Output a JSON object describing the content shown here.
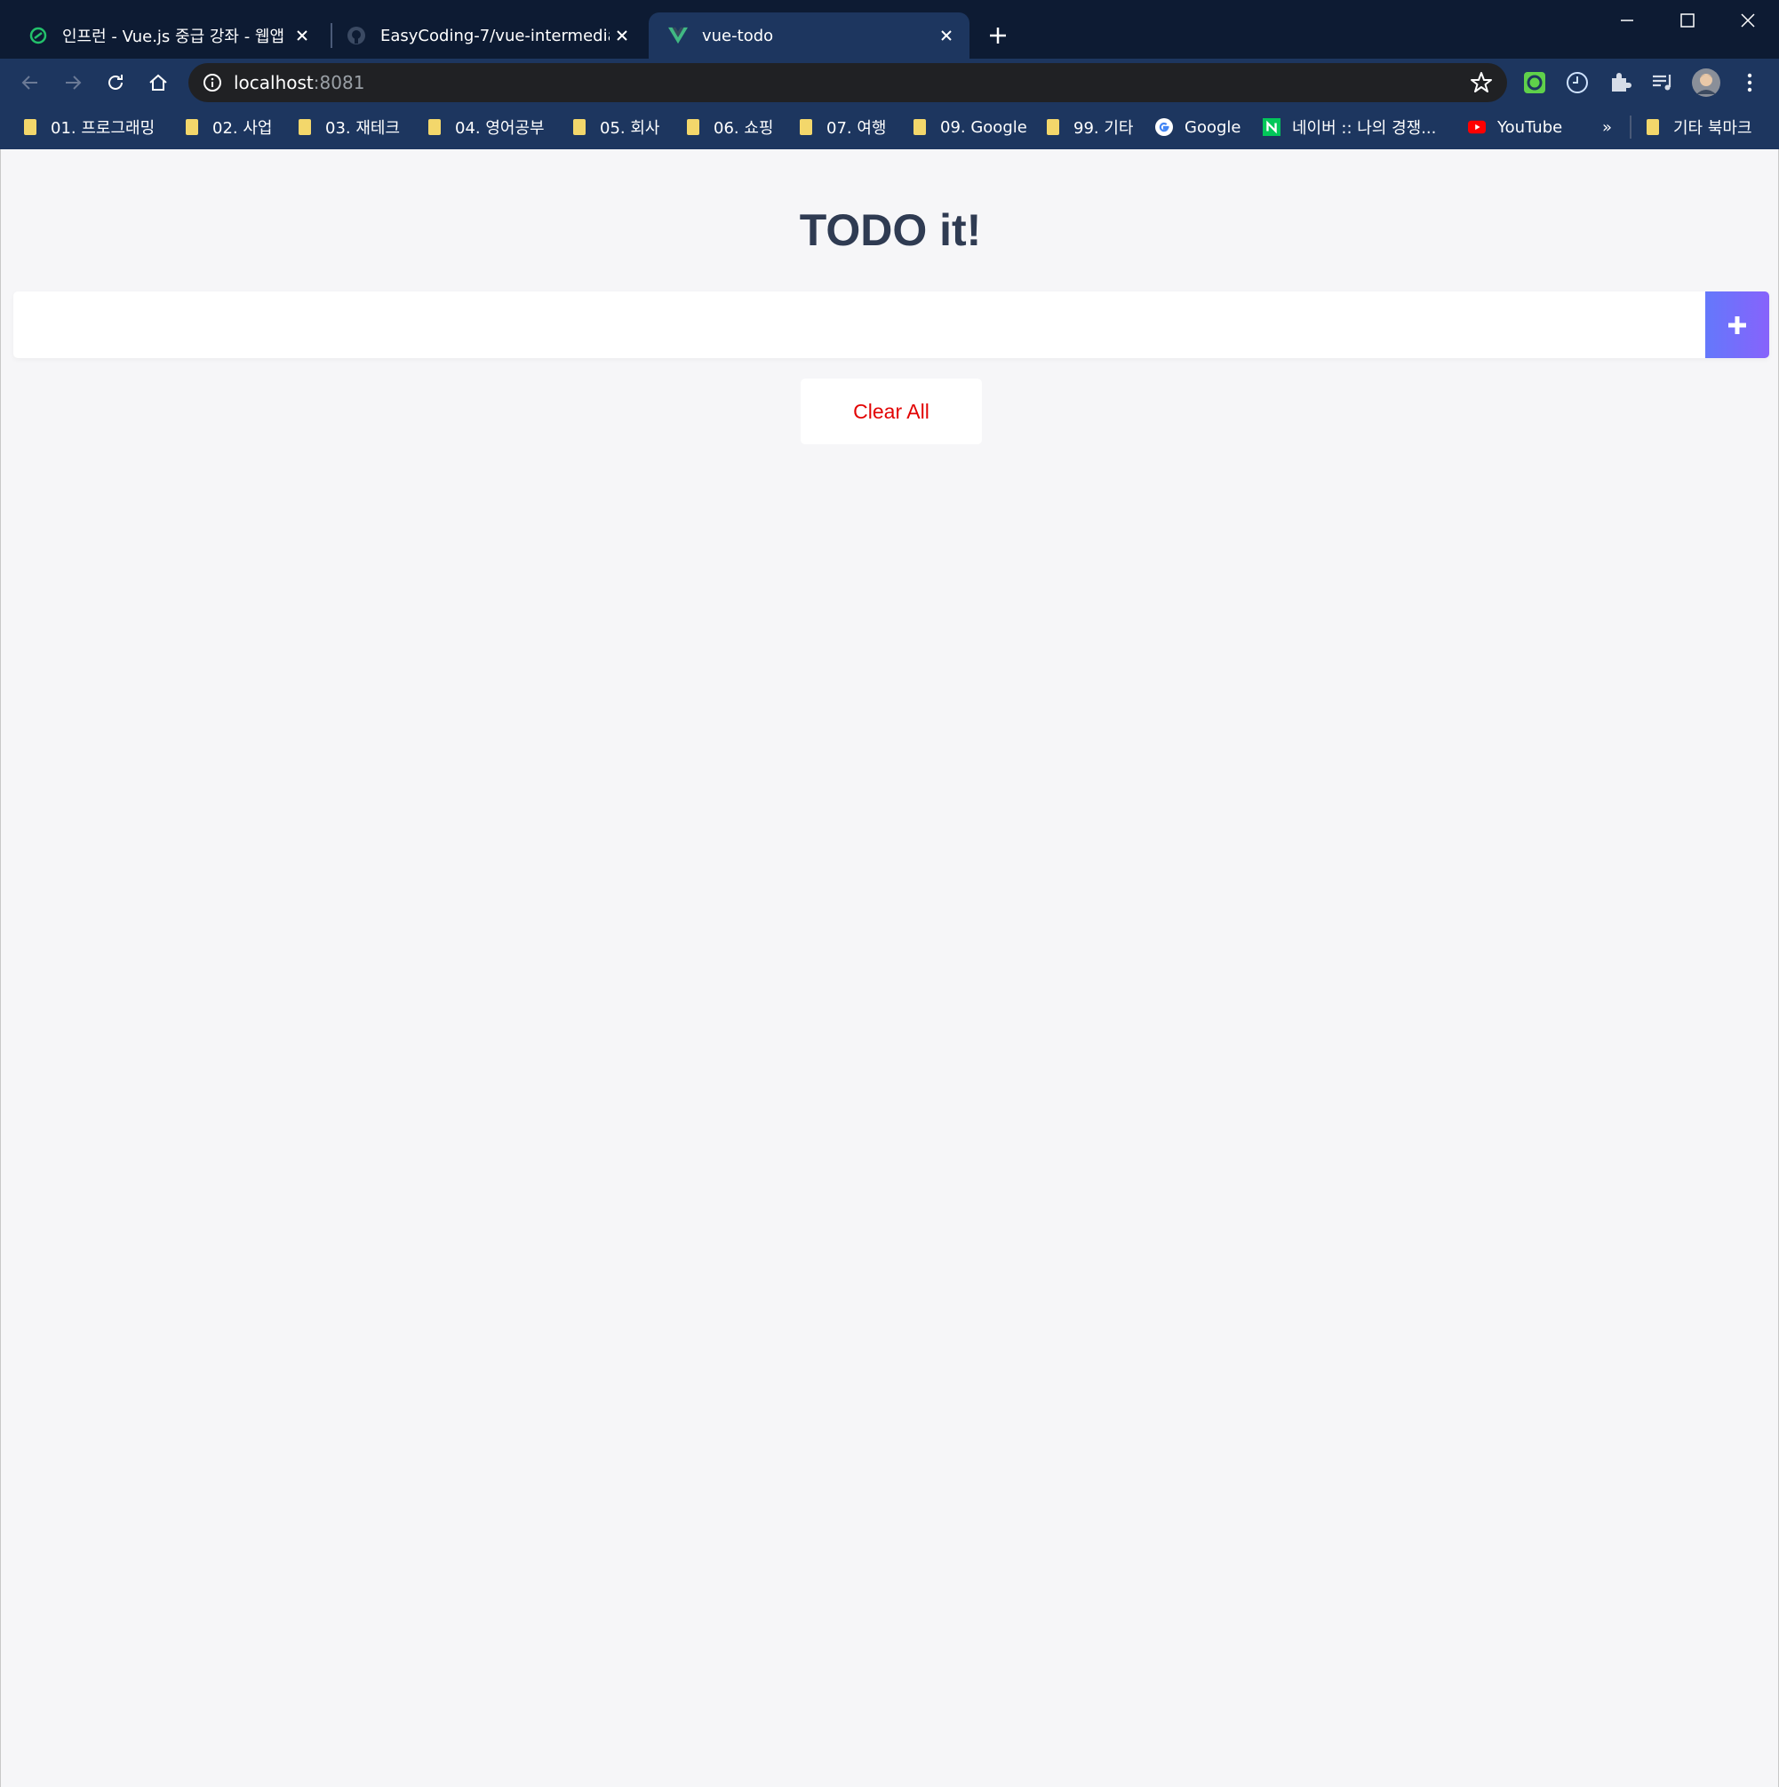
{
  "browser": {
    "tabs": [
      {
        "title": "인프런 - Vue.js 중급 강좌 - 웹앱",
        "icon": "inflearn-icon",
        "active": false
      },
      {
        "title": "EasyCoding-7/vue-intermediate",
        "icon": "github-icon",
        "active": false
      },
      {
        "title": "vue-todo",
        "icon": "vue-icon",
        "active": true
      }
    ],
    "url": {
      "host": "localhost",
      "port": ":8081"
    },
    "bookmarks": [
      {
        "label": "01. 프로그래밍",
        "icon": "folder-icon"
      },
      {
        "label": "02. 사업",
        "icon": "folder-icon"
      },
      {
        "label": "03. 재테크",
        "icon": "folder-icon"
      },
      {
        "label": "04. 영어공부",
        "icon": "folder-icon"
      },
      {
        "label": "05. 회사",
        "icon": "folder-icon"
      },
      {
        "label": "06. 쇼핑",
        "icon": "folder-icon"
      },
      {
        "label": "07. 여행",
        "icon": "folder-icon"
      },
      {
        "label": "09. Google",
        "icon": "folder-icon"
      },
      {
        "label": "99. 기타",
        "icon": "folder-icon"
      },
      {
        "label": "Google",
        "icon": "google-icon"
      },
      {
        "label": "네이버 :: 나의 경쟁...",
        "icon": "naver-icon"
      },
      {
        "label": "YouTube",
        "icon": "youtube-icon"
      }
    ],
    "bookmarks_overflow": "»",
    "other_bookmarks": "기타 북마크"
  },
  "app": {
    "title": "TODO it!",
    "input_value": "",
    "clear_label": "Clear All"
  },
  "colors": {
    "chrome_frame": "#0d1b33",
    "chrome_toolbar": "#1d365f",
    "page_bg": "#f6f6f8",
    "title": "#2f3b52",
    "add_gradient_start": "#6478fb",
    "add_gradient_end": "#8763fb",
    "clear_text": "#e20303"
  }
}
